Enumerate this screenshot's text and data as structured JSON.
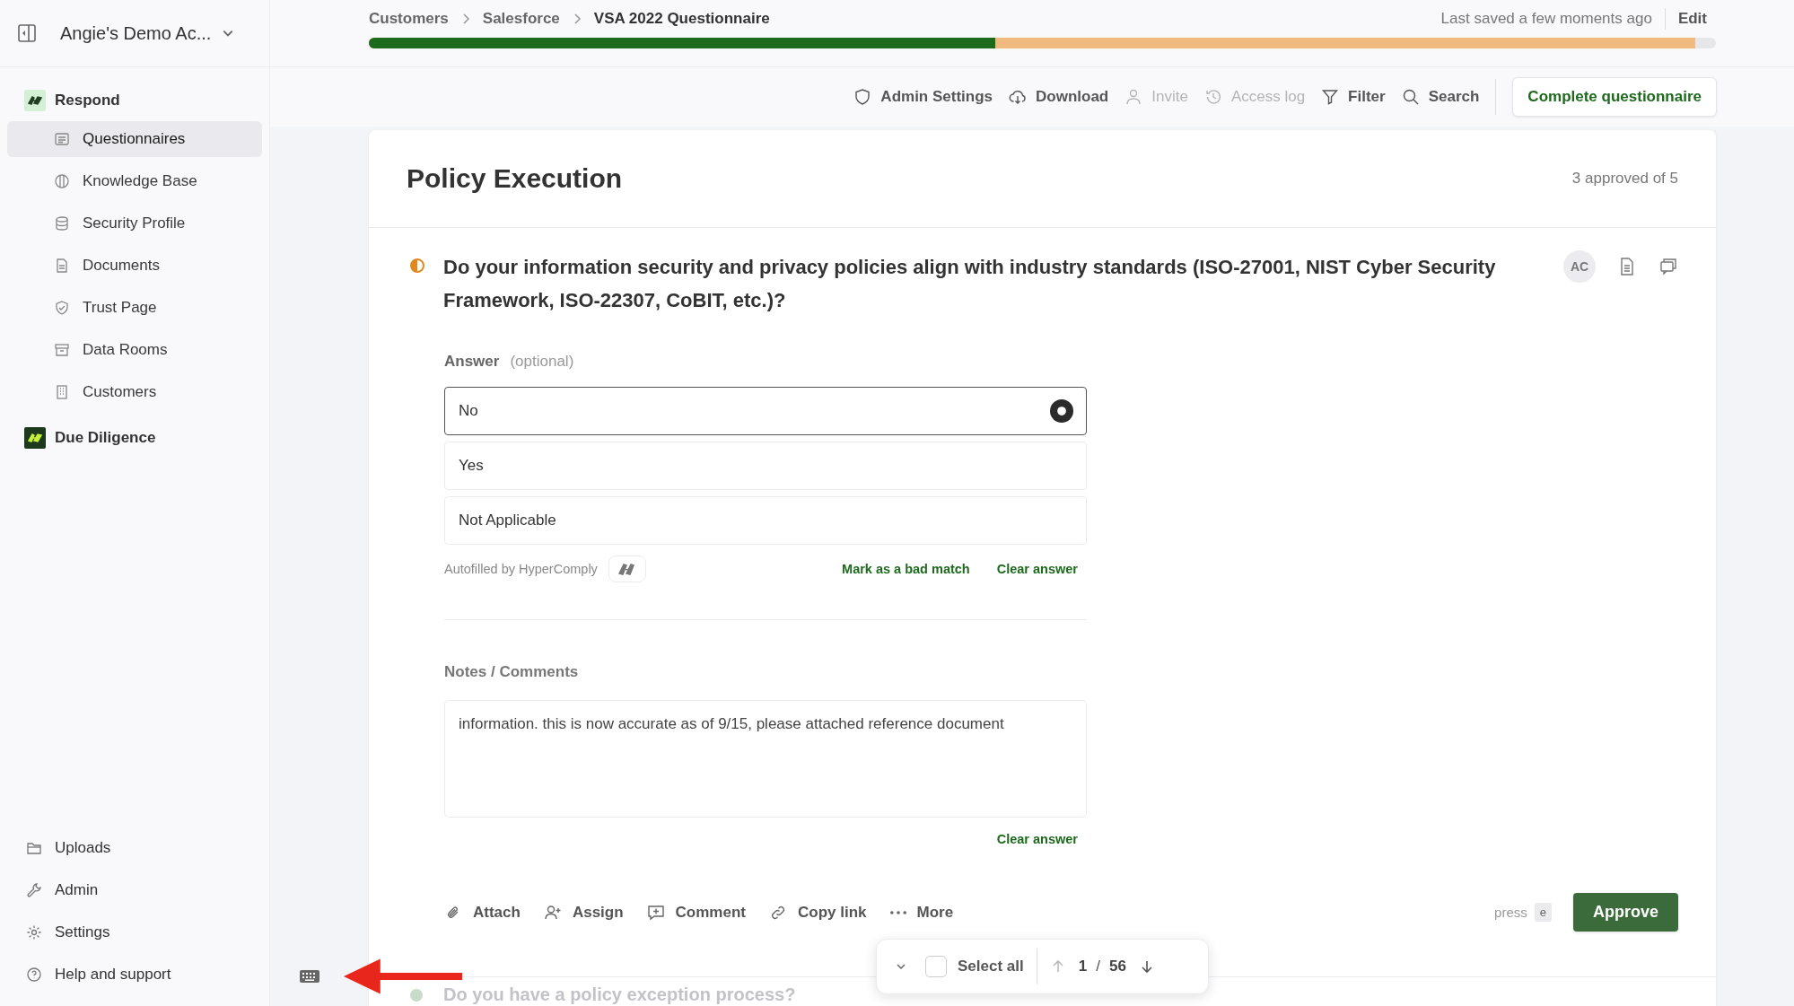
{
  "sidebar": {
    "account": "Angie's Demo Ac...",
    "sections": [
      {
        "title": "Respond",
        "kind": "light",
        "items": [
          {
            "label": "Questionnaires",
            "selected": true
          },
          {
            "label": "Knowledge Base",
            "selected": false
          },
          {
            "label": "Security Profile",
            "selected": false
          },
          {
            "label": "Documents",
            "selected": false
          },
          {
            "label": "Trust Page",
            "selected": false
          },
          {
            "label": "Data Rooms",
            "selected": false
          },
          {
            "label": "Customers",
            "selected": false
          }
        ]
      },
      {
        "title": "Due Diligence",
        "kind": "dark"
      }
    ],
    "footer_items": [
      "Uploads",
      "Admin",
      "Settings",
      "Help and support"
    ]
  },
  "breadcrumbs": [
    "Customers",
    "Salesforce",
    "VSA 2022 Questionnaire"
  ],
  "save_status": "Last saved a few moments ago",
  "edit": "Edit",
  "progress": [
    {
      "level": 0.465,
      "color": "#1d6a1d"
    },
    {
      "level": 0.985,
      "color": "#f0b97d"
    }
  ],
  "toolbar": [
    {
      "label": "Admin Settings",
      "disabled": false
    },
    {
      "label": "Download",
      "disabled": false
    },
    {
      "label": "Invite",
      "disabled": true
    },
    {
      "label": "Access log",
      "disabled": true
    },
    {
      "label": "Filter",
      "disabled": false
    },
    {
      "label": "Search",
      "disabled": false
    }
  ],
  "complete": "Complete questionnaire",
  "section": {
    "title": "Policy Execution",
    "approved": "3 approved of 5"
  },
  "question": {
    "text": "Do your information security and privacy policies align with industry standards (ISO-27001, NIST Cyber Security Framework, ISO-22307, CoBIT, etc.)?",
    "assignee": "AC"
  },
  "answer": {
    "label": "Answer",
    "hint": "(optional)",
    "options": [
      {
        "label": "No",
        "selected": true
      },
      {
        "label": "Yes",
        "selected": false
      },
      {
        "label": "Not Applicable",
        "selected": false
      }
    ],
    "autofill": "Autofilled by HyperComply",
    "links": [
      "Mark as a bad match",
      "Clear answer"
    ]
  },
  "notes": {
    "label": "Notes / Comments",
    "value": "information. this is now accurate as of 9/15, please attached reference document",
    "clear": "Clear answer"
  },
  "actions": [
    "Attach",
    "Assign",
    "Comment",
    "Copy link",
    "More"
  ],
  "press": "press",
  "key": "e",
  "approve": "Approve",
  "pager": {
    "select_all": {
      "label": "Select all",
      "checked": false
    },
    "current": "1",
    "separator": "/",
    "total": "56"
  },
  "next_question": "Do you have a policy exception process?"
}
